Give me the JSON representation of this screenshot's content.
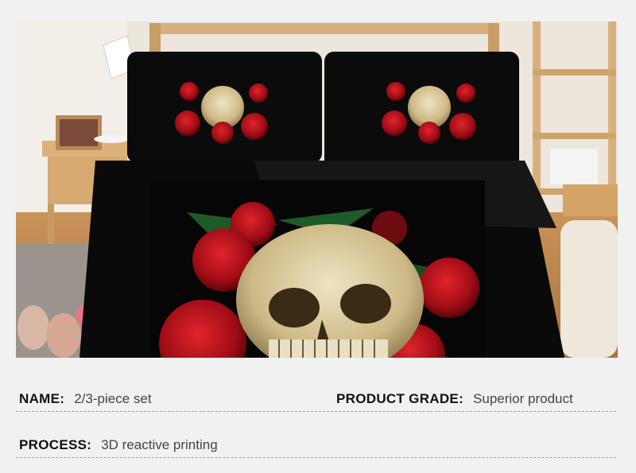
{
  "product_photo": {
    "alt": "Black duvet cover and pillowcases printed with a skull and red roses"
  },
  "specs": [
    {
      "label": "NAME:",
      "value": "2/3-piece set"
    },
    {
      "label": "PRODUCT GRADE:",
      "value": "Superior product"
    },
    {
      "label": "PROCESS:",
      "value": "3D reactive printing"
    }
  ],
  "colors": {
    "background": "#f1f1f1",
    "bedding": "#0b0b0b",
    "rose": "#b5121b",
    "skull": "#d8c9a0",
    "wood": "#d9b07d"
  }
}
